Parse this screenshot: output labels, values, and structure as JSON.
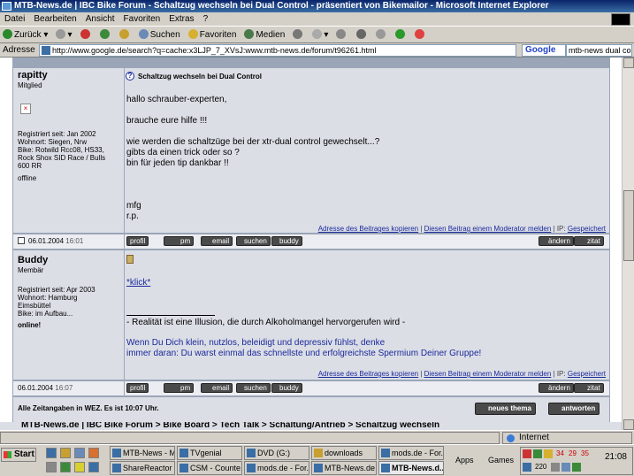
{
  "window": {
    "title": "MTB-News.de | IBC Bike Forum - Schaltzug wechseln bei Dual Control - präsentiert von Bikemailor - Microsoft Internet Explorer"
  },
  "menu": [
    "Datei",
    "Bearbeiten",
    "Ansicht",
    "Favoriten",
    "Extras",
    "?"
  ],
  "toolbar": {
    "back": "Zurück",
    "search": "Suchen",
    "favorites": "Favoriten",
    "media": "Medien"
  },
  "address": {
    "label": "Adresse",
    "url": "http://www.google.de/search?q=cache:x3LJP_7_XVsJ:www.mtb-news.de/forum/t96261.html",
    "google": "Google",
    "search_value": "mtb-news dual cont"
  },
  "posts": [
    {
      "user": "rapitty",
      "rank": "Mitglied",
      "info": "Registriert seit: Jan 2002\nWohnort: Siegen, Nrw\nBike: Rotwild Rcc08, HS33,\nRock Shox SID Race / Bulls\n600 RR",
      "status": "offline",
      "subject": "Schaltzug wechseln bei Dual Control",
      "body": "hallo schrauber-experten,\n\nbrauche eure hilfe !!!\n\nwie werden die schaltzüge bei der xtr-dual control gewechselt...?\ngibts da einen trick oder so ?\nbin für jeden tip dankbar !!\n\n\n\nmfg\nr.p.",
      "date": "06.01.2004",
      "time": "16:01"
    },
    {
      "user": "Buddy",
      "rank": "Membär",
      "info": "Registriert seit: Apr 2003\nWohnort: Hamburg\nEimsbüttel\nBike: im Aufbau...",
      "status": "online!",
      "link": "*klick*",
      "sig1": "- Realität ist eine Illusion, die durch Alkoholmangel hervorgerufen wird -",
      "sig2": "Wenn Du Dich klein, nutzlos, beleidigt und depressiv fühlst, denke\nimmer daran: Du warst einmal das schnellste und erfolgreichste Spermium Deiner Gruppe!",
      "date": "06.01.2004",
      "time": "16:07"
    }
  ],
  "actions": {
    "copy": "Adresse des Beitrages kopieren",
    "report": "Diesen Beitrag einem Moderator melden",
    "ip_label": "| IP:",
    "ip": "Gespeichert"
  },
  "buttons": {
    "profil": "profil",
    "pm": "pm",
    "email": "email",
    "suchen": "suchen",
    "buddy": "buddy",
    "aendern": "ändern",
    "zitat": "zitat"
  },
  "timezone": "Alle Zeitangaben in WEZ. Es ist 10:07 Uhr.",
  "bigbuttons": {
    "new": "neues thema",
    "reply": "antworten"
  },
  "nav": "MTB-News.de | IBC Bike Forum > Bike Board > Tech Talk > Schaltung/Antrieb > Schaltzug wechseln",
  "status": {
    "zone": "Internet"
  },
  "taskbar": {
    "start": "Start",
    "tasks": [
      "MTB-News - M...",
      "TVgenial",
      "DVD (G:)",
      "downloads",
      "mods.de - For...",
      "ShareReactor ...",
      "CSM - Counte...",
      "mods.de - For...",
      "MTB-News.de ...",
      "MTB-News.d..."
    ],
    "apps": "Apps",
    "games": "Games",
    "clock": "21:08",
    "tray_nums": [
      "34",
      "29",
      "35",
      "220"
    ]
  }
}
